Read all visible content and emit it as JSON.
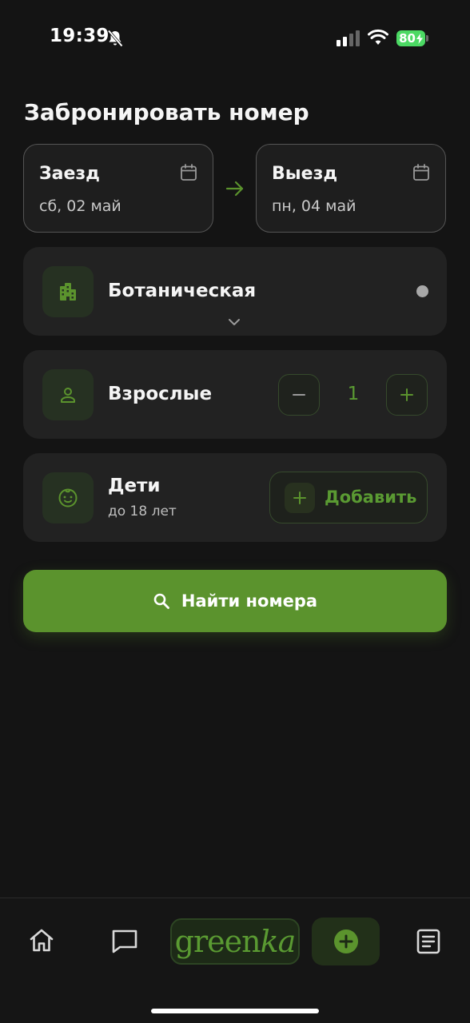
{
  "status_bar": {
    "time": "19:39",
    "battery_level": "80",
    "icons": [
      "bell-off-icon",
      "signal-icon",
      "wifi-icon",
      "battery-charging-icon"
    ]
  },
  "page": {
    "title": "Забронировать номер"
  },
  "dates": {
    "checkin_label": "Заезд",
    "checkin_value": "сб, 02 май",
    "checkout_label": "Выезд",
    "checkout_value": "пн, 04 май"
  },
  "location": {
    "name": "Ботаническая",
    "icon": "building-icon"
  },
  "adults": {
    "label": "Взрослые",
    "count": "1",
    "icon": "person-icon"
  },
  "children": {
    "label": "Дети",
    "sublabel": "до 18 лет",
    "add_label": "Добавить",
    "icon": "child-face-icon"
  },
  "search": {
    "label": "Найти номера"
  },
  "bottom_nav": {
    "brand_main": "green",
    "brand_tail": "ka",
    "items": [
      "home-icon",
      "chat-icon",
      "brand-logo",
      "add-circle-icon",
      "document-list-icon"
    ]
  },
  "colors": {
    "accent": "#5b932d",
    "accent_text": "#5a9a32",
    "background": "#141414",
    "card": "#222222"
  }
}
